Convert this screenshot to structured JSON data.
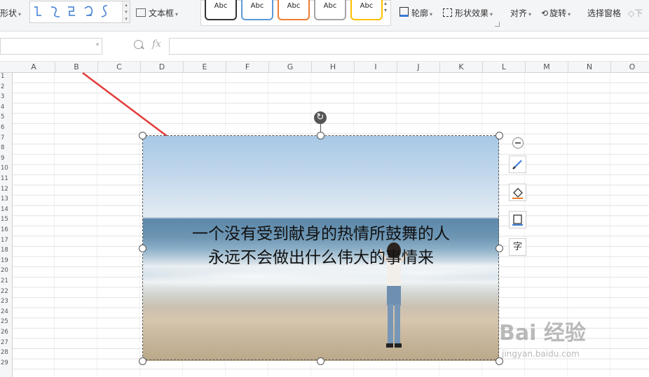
{
  "ribbon": {
    "shape_label": "形状",
    "textbox_label": "文本框",
    "style_samples": [
      {
        "label": "Abc",
        "color": "#333333"
      },
      {
        "label": "Abc",
        "color": "#5b9bd5"
      },
      {
        "label": "Abc",
        "color": "#ed7d31"
      },
      {
        "label": "Abc",
        "color": "#a5a5a5"
      },
      {
        "label": "Abc",
        "color": "#ffc000"
      }
    ],
    "outline_label": "轮廓",
    "shape_effects_label": "形状效果",
    "align_label": "对齐",
    "rotate_label": "旋转",
    "selection_pane_label": "选择窗格",
    "next_label": "下"
  },
  "formula_bar": {
    "name_box_value": "",
    "fx_label": "fx",
    "formula_value": ""
  },
  "sheet": {
    "columns": [
      "A",
      "B",
      "C",
      "D",
      "E",
      "F",
      "G",
      "H",
      "I",
      "J",
      "K",
      "L",
      "M",
      "N",
      "O"
    ],
    "rows": [
      "1",
      "2",
      "3",
      "4",
      "5",
      "6",
      "7",
      "8",
      "9",
      "10",
      "11",
      "12",
      "13",
      "14",
      "15",
      "16",
      "17",
      "18",
      "19",
      "20",
      "21",
      "22",
      "23",
      "24",
      "25",
      "26",
      "27",
      "28",
      "29"
    ]
  },
  "picture": {
    "text_line1": "一个没有受到献身的热情所鼓舞的人",
    "text_line2": "永远不会做出什么伟大的事情来"
  },
  "side_toolbar": {
    "textbox_glyph": "字"
  },
  "watermark": {
    "main": "Bai 经验",
    "sub": "jingyan.baidu.com"
  },
  "colors": {
    "accent_arrow": "#e23b3b",
    "selection": "#555555"
  }
}
